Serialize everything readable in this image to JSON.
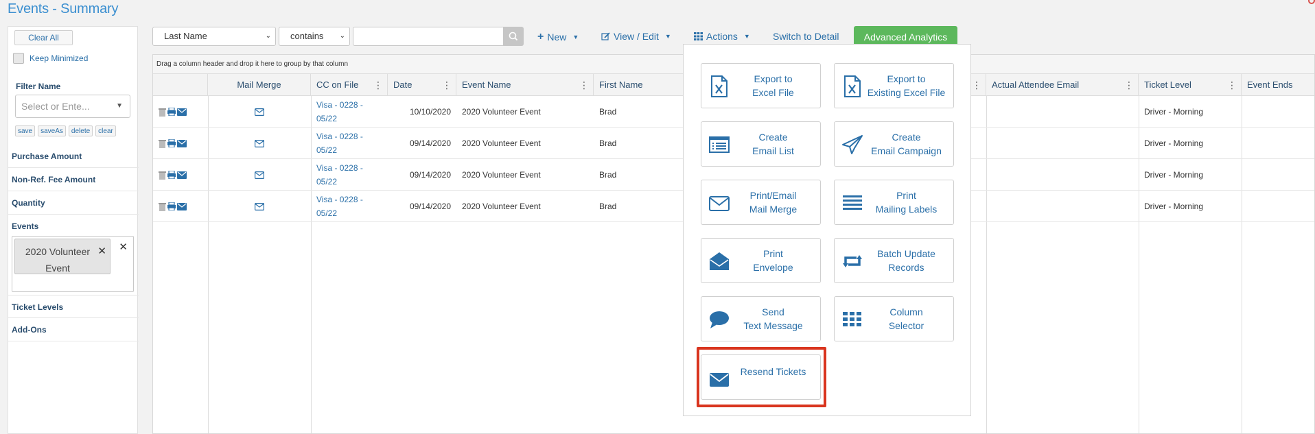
{
  "page": {
    "title": "Events - Summary"
  },
  "sidebar": {
    "clear_all": "Clear All",
    "keep_minimized": "Keep Minimized",
    "filter_name_label": "Filter Name",
    "filter_placeholder": "Select or Ente...",
    "mini_buttons": [
      "save",
      "saveAs",
      "delete",
      "clear"
    ],
    "sections": {
      "purchase_amount": "Purchase Amount",
      "non_ref_fee": "Non-Ref. Fee Amount",
      "quantity": "Quantity",
      "events": "Events",
      "ticket_levels": "Ticket Levels",
      "add_ons": "Add-Ons"
    },
    "events_chip": "2020 Volunteer Event"
  },
  "toolbar": {
    "field": "Last Name",
    "operator": "contains",
    "search_value": "",
    "new_label": "New",
    "view_edit_label": "View / Edit",
    "actions_label": "Actions",
    "switch_label": "Switch to Detail",
    "advanced_label": "Advanced Analytics"
  },
  "grid": {
    "group_hint": "Drag a column header and drop it here to group by that column",
    "columns": {
      "mail_merge": "Mail Merge",
      "cc_on_file": "CC on File",
      "date": "Date",
      "event_name": "Event Name",
      "first_name": "First Name",
      "actual_attendee_email": "Actual Attendee Email",
      "ticket_level": "Ticket Level",
      "event_ends": "Event Ends"
    },
    "rows": [
      {
        "cc": "Visa - 0228 - 05/22",
        "date": "10/10/2020",
        "event": "2020 Volunteer Event",
        "first": "Brad",
        "ticket": "Driver - Morning"
      },
      {
        "cc": "Visa - 0228 - 05/22",
        "date": "09/14/2020",
        "event": "2020 Volunteer Event",
        "first": "Brad",
        "ticket": "Driver - Morning"
      },
      {
        "cc": "Visa - 0228 - 05/22",
        "date": "09/14/2020",
        "event": "2020 Volunteer Event",
        "first": "Brad",
        "ticket": "Driver - Morning"
      },
      {
        "cc": "Visa - 0228 - 05/22",
        "date": "09/14/2020",
        "event": "2020 Volunteer Event",
        "first": "Brad",
        "ticket": "Driver - Morning"
      }
    ]
  },
  "actions_menu": {
    "export_excel": "Export to\nExcel File",
    "export_existing": "Export to\nExisting Excel File",
    "create_email_list": "Create\nEmail List",
    "create_email_campaign": "Create\nEmail Campaign",
    "print_mail_merge": "Print/Email\nMail Merge",
    "print_labels": "Print\nMailing Labels",
    "print_envelope": "Print\nEnvelope",
    "batch_update": "Batch Update\nRecords",
    "send_text": "Send\nText Message",
    "column_selector": "Column\nSelector",
    "resend_tickets": "Resend Tickets"
  },
  "colors": {
    "accent": "#2a6fa8",
    "title": "#3b8fd0",
    "green": "#5cb85c",
    "highlight": "#d9351f"
  }
}
